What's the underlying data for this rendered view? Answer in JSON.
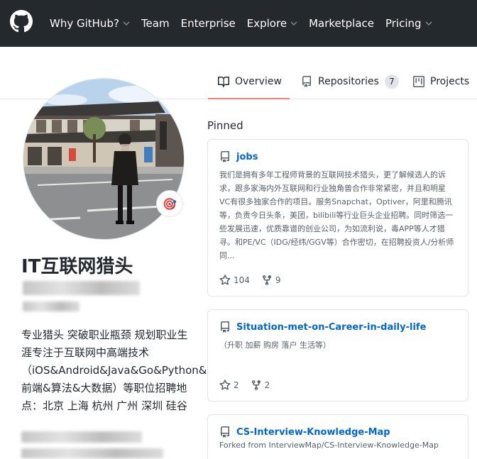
{
  "header": {
    "nav": [
      {
        "label": "Why GitHub?",
        "dropdown": true
      },
      {
        "label": "Team",
        "dropdown": false
      },
      {
        "label": "Enterprise",
        "dropdown": false
      },
      {
        "label": "Explore",
        "dropdown": true
      },
      {
        "label": "Marketplace",
        "dropdown": false
      },
      {
        "label": "Pricing",
        "dropdown": true
      }
    ]
  },
  "tabs": [
    {
      "label": "Overview",
      "icon": "book-icon",
      "selected": true
    },
    {
      "label": "Repositories",
      "icon": "repo-icon",
      "count": "7"
    },
    {
      "label": "Projects",
      "icon": "project-icon"
    }
  ],
  "profile": {
    "name": "IT互联网猎头",
    "status_emoji": "🎯",
    "bio": "专业猎头 突破职业瓶颈 规划职业生涯专注于互联网中高端技术（iOS&Android&Java&Go&Python&Ruby&node.js&前端&算法&大数据）等职位招聘地点：北京 上海 杭州 广州 深圳 硅谷"
  },
  "pinned": {
    "title": "Pinned",
    "repos": [
      {
        "name": "jobs",
        "description": "我们是拥有多年工程师背景的互联网技术猎头，更了解候选人的诉求，跟多家海内外互联网和行业独角兽合作非常紧密，并且和明星VC有很多独家合作的项目。服务Snapchat，Optiver，阿里和腾讯等，负责今日头条，美团，bilibili等行业巨头企业招聘。同时筛选一些发展迅速，优质靠谱的创业公司，为如流利说，毒APP等人才猎寻。和PE/VC（IDG/经纬/GGV等）合作密切，在招聘投资人/分析师同...",
        "stars": "104",
        "forks": "9"
      },
      {
        "name": "Situation-met-on-Career-in-daily-life",
        "description": "（升职 加薪 购房 落户 生活等）",
        "stars": "2",
        "forks": "2"
      },
      {
        "name": "CS-Interview-Knowledge-Map",
        "forked_from": "Forked from InterviewMap/CS-Interview-Knowledge-Map"
      }
    ]
  },
  "colors": {
    "header_bg": "#24292e",
    "link": "#0366d6",
    "tab_underline": "#f9826c",
    "border": "#e1e4e8"
  }
}
